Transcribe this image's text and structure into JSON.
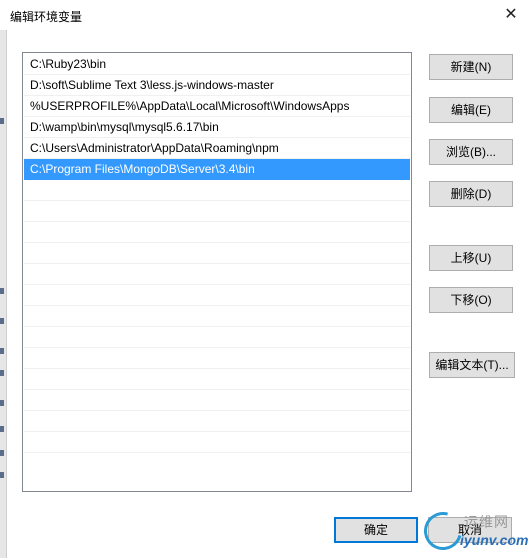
{
  "window": {
    "title": "编辑环境变量",
    "close_glyph": "✕"
  },
  "path_list": {
    "items": [
      {
        "label": "C:\\Ruby23\\bin",
        "selected": false
      },
      {
        "label": "D:\\soft\\Sublime Text 3\\less.js-windows-master",
        "selected": false
      },
      {
        "label": "%USERPROFILE%\\AppData\\Local\\Microsoft\\WindowsApps",
        "selected": false
      },
      {
        "label": "D:\\wamp\\bin\\mysql\\mysql5.6.17\\bin",
        "selected": false
      },
      {
        "label": "C:\\Users\\Administrator\\AppData\\Roaming\\npm",
        "selected": false
      },
      {
        "label": "C:\\Program Files\\MongoDB\\Server\\3.4\\bin",
        "selected": true
      }
    ],
    "empty_rows": 13,
    "selection_color": "#3399ff"
  },
  "buttons": {
    "new": "新建(N)",
    "edit": "编辑(E)",
    "browse": "浏览(B)...",
    "delete": "删除(D)",
    "move_up": "上移(U)",
    "move_down": "下移(O)",
    "edit_text": "编辑文本(T)...",
    "ok": "确定",
    "cancel": "取消"
  },
  "watermark": {
    "line1": "运维网",
    "line2": "iyunv.com"
  },
  "colors": {
    "accent": "#0078d7",
    "button_bg": "#e1e1e1",
    "button_border": "#adadad"
  }
}
